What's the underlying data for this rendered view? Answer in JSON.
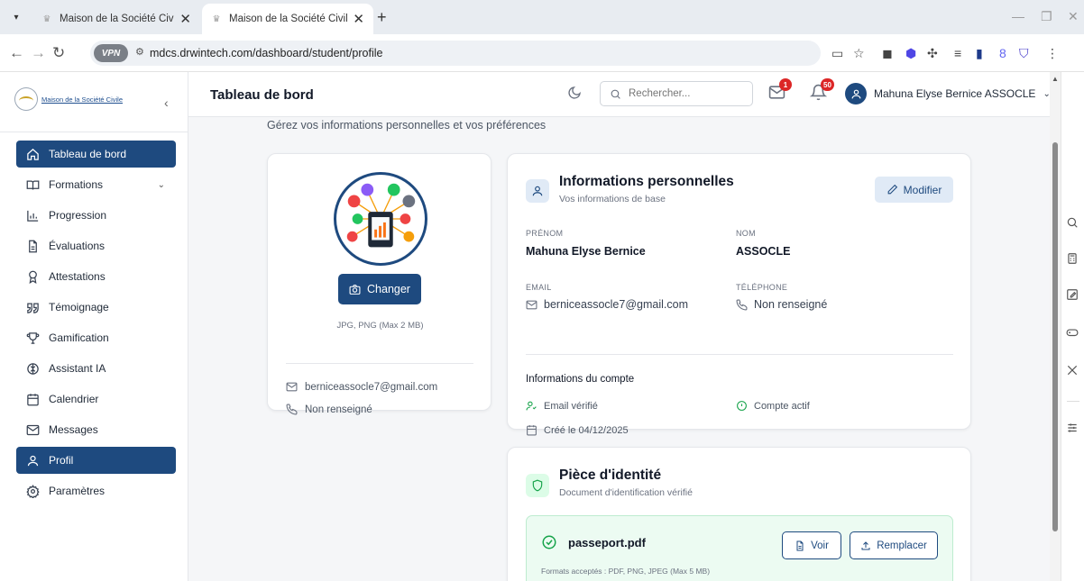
{
  "browser": {
    "tabs": [
      {
        "title": "Maison de la Société Civile - Pla",
        "active": false
      },
      {
        "title": "Maison de la Société Civile - Pla",
        "active": true
      }
    ],
    "url": "mdcs.drwintech.com/dashboard/student/profile",
    "vpn_label": "VPN"
  },
  "sidebar": {
    "logo_text": "Maison de la Société Civile",
    "items": [
      {
        "label": "Tableau de bord",
        "icon": "home-icon",
        "active": true
      },
      {
        "label": "Formations",
        "icon": "book-icon",
        "active": false,
        "expandable": true
      },
      {
        "label": "Progression",
        "icon": "bar-chart-icon",
        "active": false
      },
      {
        "label": "Évaluations",
        "icon": "document-icon",
        "active": false
      },
      {
        "label": "Attestations",
        "icon": "award-icon",
        "active": false
      },
      {
        "label": "Témoignage",
        "icon": "quote-icon",
        "active": false
      },
      {
        "label": "Gamification",
        "icon": "trophy-icon",
        "active": false
      },
      {
        "label": "Assistant IA",
        "icon": "brain-icon",
        "active": false
      },
      {
        "label": "Calendrier",
        "icon": "calendar-icon",
        "active": false
      },
      {
        "label": "Messages",
        "icon": "mail-icon",
        "active": false
      },
      {
        "label": "Profil",
        "icon": "user-icon",
        "active": true
      },
      {
        "label": "Paramètres",
        "icon": "settings-icon",
        "active": false
      }
    ]
  },
  "header": {
    "title": "Tableau de bord",
    "search_placeholder": "Rechercher...",
    "messages_count": "1",
    "notifications_count": "50",
    "user_name": "Mahuna Elyse Bernice ASSOCLE"
  },
  "main": {
    "subtitle": "Gérez vos informations personnelles et vos préférences",
    "profile_card": {
      "change_label": "Changer",
      "formats": "JPG, PNG (Max 2 MB)",
      "email": "berniceassocle7@gmail.com",
      "phone": "Non renseigné"
    },
    "info_card": {
      "title": "Informations personnelles",
      "subtitle": "Vos informations de base",
      "edit_label": "Modifier",
      "first_name_label": "PRÉNOM",
      "first_name": "Mahuna Elyse Bernice",
      "last_name_label": "NOM",
      "last_name": "ASSOCLE",
      "email_label": "EMAIL",
      "email": "berniceassocle7@gmail.com",
      "phone_label": "TÉLÉPHONE",
      "phone": "Non renseigné",
      "account_title": "Informations du compte",
      "email_verified": "Email vérifié",
      "account_active": "Compte actif",
      "created": "Créé le 04/12/2025"
    },
    "id_card": {
      "title": "Pièce d'identité",
      "subtitle": "Document d'identification vérifié",
      "file_name": "passeport.pdf",
      "view_label": "Voir",
      "replace_label": "Remplacer",
      "formats": "Formats acceptés : PDF, PNG, JPEG (Max 5 MB)"
    }
  },
  "colors": {
    "primary": "#1e4a7f",
    "success": "#16a34a",
    "badge": "#dc2626",
    "page_bg": "#f5f6f8"
  }
}
